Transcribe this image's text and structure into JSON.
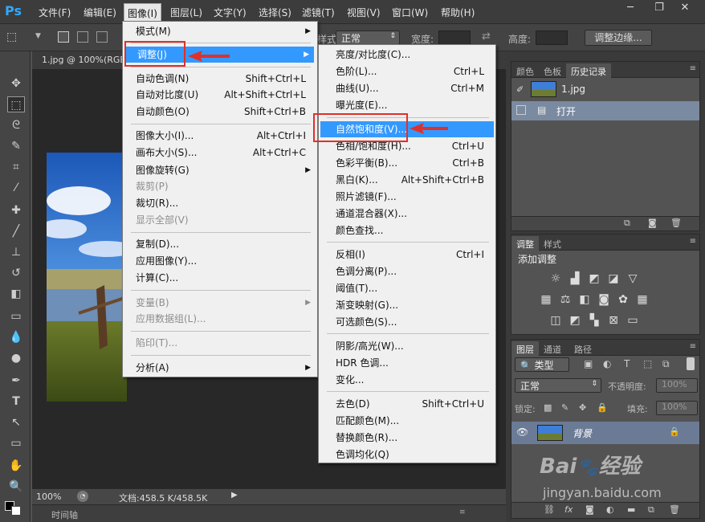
{
  "app": {
    "logo": "Ps"
  },
  "menubar": {
    "items": [
      "文件(F)",
      "编辑(E)",
      "图像(I)",
      "图层(L)",
      "文字(Y)",
      "选择(S)",
      "滤镜(T)",
      "视图(V)",
      "窗口(W)",
      "帮助(H)"
    ],
    "active": "图像(I)"
  },
  "window_controls": {
    "minimize": "─",
    "restore": "❐",
    "close": "✕"
  },
  "options_bar": {
    "style_label": "样式:",
    "style_value": "正常",
    "width_label": "宽度:",
    "height_label": "高度:",
    "refine_button": "调整边缘..."
  },
  "document": {
    "tab_title": "1.jpg @ 100%(RGB",
    "zoom": "100%",
    "doc_info": "文档:458.5 K/458.5K",
    "timeline": "时间轴"
  },
  "image_menu": {
    "items": [
      {
        "label": "模式(M)",
        "submenu": true
      },
      {
        "label": "调整(J)",
        "submenu": true,
        "highlighted": true
      },
      {
        "label": "自动色调(N)",
        "shortcut": "Shift+Ctrl+L"
      },
      {
        "label": "自动对比度(U)",
        "shortcut": "Alt+Shift+Ctrl+L"
      },
      {
        "label": "自动颜色(O)",
        "shortcut": "Shift+Ctrl+B"
      },
      {
        "label": "图像大小(I)...",
        "shortcut": "Alt+Ctrl+I"
      },
      {
        "label": "画布大小(S)...",
        "shortcut": "Alt+Ctrl+C"
      },
      {
        "label": "图像旋转(G)",
        "submenu": true
      },
      {
        "label": "裁剪(P)",
        "disabled": true
      },
      {
        "label": "裁切(R)..."
      },
      {
        "label": "显示全部(V)",
        "disabled": true
      },
      {
        "label": "复制(D)..."
      },
      {
        "label": "应用图像(Y)..."
      },
      {
        "label": "计算(C)..."
      },
      {
        "label": "变量(B)",
        "submenu": true,
        "disabled": true
      },
      {
        "label": "应用数据组(L)...",
        "disabled": true
      },
      {
        "label": "陷印(T)...",
        "disabled": true
      },
      {
        "label": "分析(A)",
        "submenu": true
      }
    ]
  },
  "adjust_menu": {
    "items": [
      {
        "label": "亮度/对比度(C)..."
      },
      {
        "label": "色阶(L)...",
        "shortcut": "Ctrl+L"
      },
      {
        "label": "曲线(U)...",
        "shortcut": "Ctrl+M"
      },
      {
        "label": "曝光度(E)..."
      },
      {
        "label": "自然饱和度(V)...",
        "highlighted": true
      },
      {
        "label": "色相/饱和度(H)...",
        "shortcut": "Ctrl+U"
      },
      {
        "label": "色彩平衡(B)...",
        "shortcut": "Ctrl+B"
      },
      {
        "label": "黑白(K)...",
        "shortcut": "Alt+Shift+Ctrl+B"
      },
      {
        "label": "照片滤镜(F)..."
      },
      {
        "label": "通道混合器(X)..."
      },
      {
        "label": "颜色查找..."
      },
      {
        "label": "反相(I)",
        "shortcut": "Ctrl+I"
      },
      {
        "label": "色调分离(P)..."
      },
      {
        "label": "阈值(T)..."
      },
      {
        "label": "渐变映射(G)..."
      },
      {
        "label": "可选颜色(S)..."
      },
      {
        "label": "阴影/高光(W)..."
      },
      {
        "label": "HDR 色调..."
      },
      {
        "label": "变化..."
      },
      {
        "label": "去色(D)",
        "shortcut": "Shift+Ctrl+U"
      },
      {
        "label": "匹配颜色(M)..."
      },
      {
        "label": "替换颜色(R)..."
      },
      {
        "label": "色调均化(Q)"
      }
    ]
  },
  "history_panel": {
    "tabs": [
      "颜色",
      "色板",
      "历史记录"
    ],
    "snapshot": "1.jpg",
    "states": [
      "打开"
    ]
  },
  "adjustments_panel": {
    "tabs": [
      "调整",
      "样式"
    ],
    "title": "添加调整"
  },
  "layers_panel": {
    "tabs": [
      "图层",
      "通道",
      "路径"
    ],
    "filter_label": "类型",
    "blend_mode": "正常",
    "opacity_label": "不透明度:",
    "opacity_value": "100%",
    "lock_label": "锁定:",
    "fill_label": "填充:",
    "fill_value": "100%",
    "layers": [
      {
        "name": "背景",
        "visible": true,
        "locked": true
      }
    ]
  },
  "watermark": {
    "brand": "Bai",
    "brand2": "经验",
    "url": "jingyan.baidu.com"
  },
  "colors": {
    "highlight": "#3399ff",
    "annotation": "#e0302a",
    "menu_bg": "#f0f0f0"
  }
}
